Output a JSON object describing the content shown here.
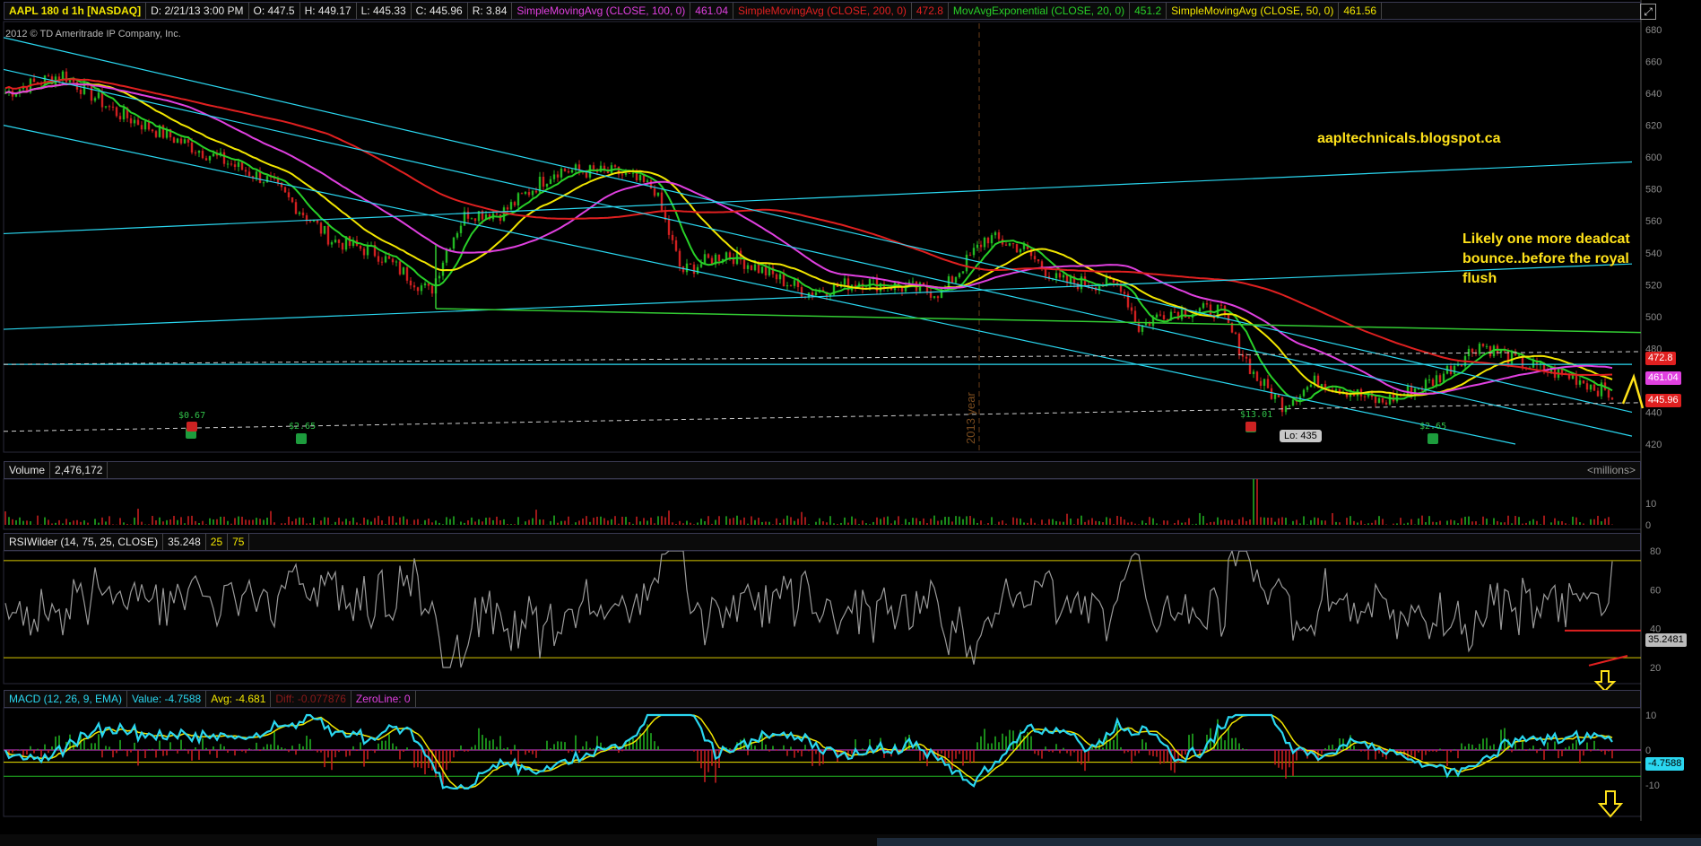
{
  "price_header": {
    "symbol": "AAPL 180 d 1h [NASDAQ]",
    "date": "D: 2/21/13 3:00 PM",
    "open": "O: 447.5",
    "high": "H: 449.17",
    "low": "L: 445.33",
    "close": "C: 445.96",
    "range": "R: 3.84",
    "studies": [
      {
        "label": "SimpleMovingAvg (CLOSE, 100, 0)",
        "value": "461.04",
        "color": "#e040e0"
      },
      {
        "label": "SimpleMovingAvg (CLOSE, 200, 0)",
        "value": "472.8",
        "color": "#e02020"
      },
      {
        "label": "MovAvgExponential (CLOSE, 20, 0)",
        "value": "451.2",
        "color": "#28d028"
      },
      {
        "label": "SimpleMovingAvg (CLOSE, 50, 0)",
        "value": "461.56",
        "color": "#f2e600"
      }
    ]
  },
  "copyright": "2012 © TD Ameritrade IP Company, Inc.",
  "blog": "aapltechnicals.blogspot.ca",
  "annotation": "Likely one more deadcat bounce..before the royal flush",
  "year_marker": "2013 year",
  "low_label": "Lo: 435",
  "price_tags": {
    "sma200": "472.8",
    "sma100": "461.04",
    "close": "445.96"
  },
  "events": [
    "$0.67",
    "$2.65",
    "$13.01",
    "$2.65"
  ],
  "volume_header": {
    "name": "Volume",
    "value": "2,476,172",
    "units": "<millions>"
  },
  "rsi_header": {
    "name": "RSIWilder (14, 75, 25, CLOSE)",
    "value": "35.248",
    "low": "25",
    "high": "75",
    "last_tag": "35.2481"
  },
  "macd_header": {
    "name": "MACD (12, 26, 9, EMA)",
    "value": "Value: -4.7588",
    "avg": "Avg: -4.681",
    "diff": "Diff: -0.077876",
    "zero": "ZeroLine: 0",
    "last_tag": "-4.7588"
  },
  "chart_data": [
    {
      "type": "candlestick",
      "title": "AAPL 180 d 1h [NASDAQ]",
      "ylim": [
        420,
        680
      ],
      "y_ticks": [
        420,
        440,
        460,
        480,
        500,
        520,
        540,
        560,
        580,
        600,
        620,
        640,
        660,
        680
      ],
      "last_values": {
        "open": 447.5,
        "high": 449.17,
        "low": 445.33,
        "close": 445.96
      },
      "series": [
        {
          "name": "SimpleMovingAvg (CLOSE, 100, 0)",
          "last": 461.04
        },
        {
          "name": "SimpleMovingAvg (CLOSE, 200, 0)",
          "last": 472.8
        },
        {
          "name": "MovAvgExponential (CLOSE, 20, 0)",
          "last": 451.2
        },
        {
          "name": "SimpleMovingAvg (CLOSE, 50, 0)",
          "last": 461.56
        }
      ],
      "low_marker": 435
    },
    {
      "type": "bar",
      "title": "Volume",
      "value": 2476172,
      "y_ticks": [
        0,
        10
      ],
      "units": "<millions>"
    },
    {
      "type": "line",
      "title": "RSIWilder (14, 75, 25, CLOSE)",
      "value": 35.248,
      "levels": [
        25,
        75
      ],
      "y_ticks": [
        20,
        40,
        60,
        80
      ]
    },
    {
      "type": "line",
      "title": "MACD (12, 26, 9, EMA)",
      "value": -4.7588,
      "avg": -4.681,
      "diff": -0.077876,
      "zero_line": 0,
      "y_ticks": [
        -10,
        0,
        10
      ]
    }
  ],
  "colors": {
    "sma100": "#e040e0",
    "sma200": "#e02020",
    "ema20": "#28d028",
    "sma50": "#f2e600",
    "channel": "#2ad7f0",
    "background": "#000000"
  }
}
